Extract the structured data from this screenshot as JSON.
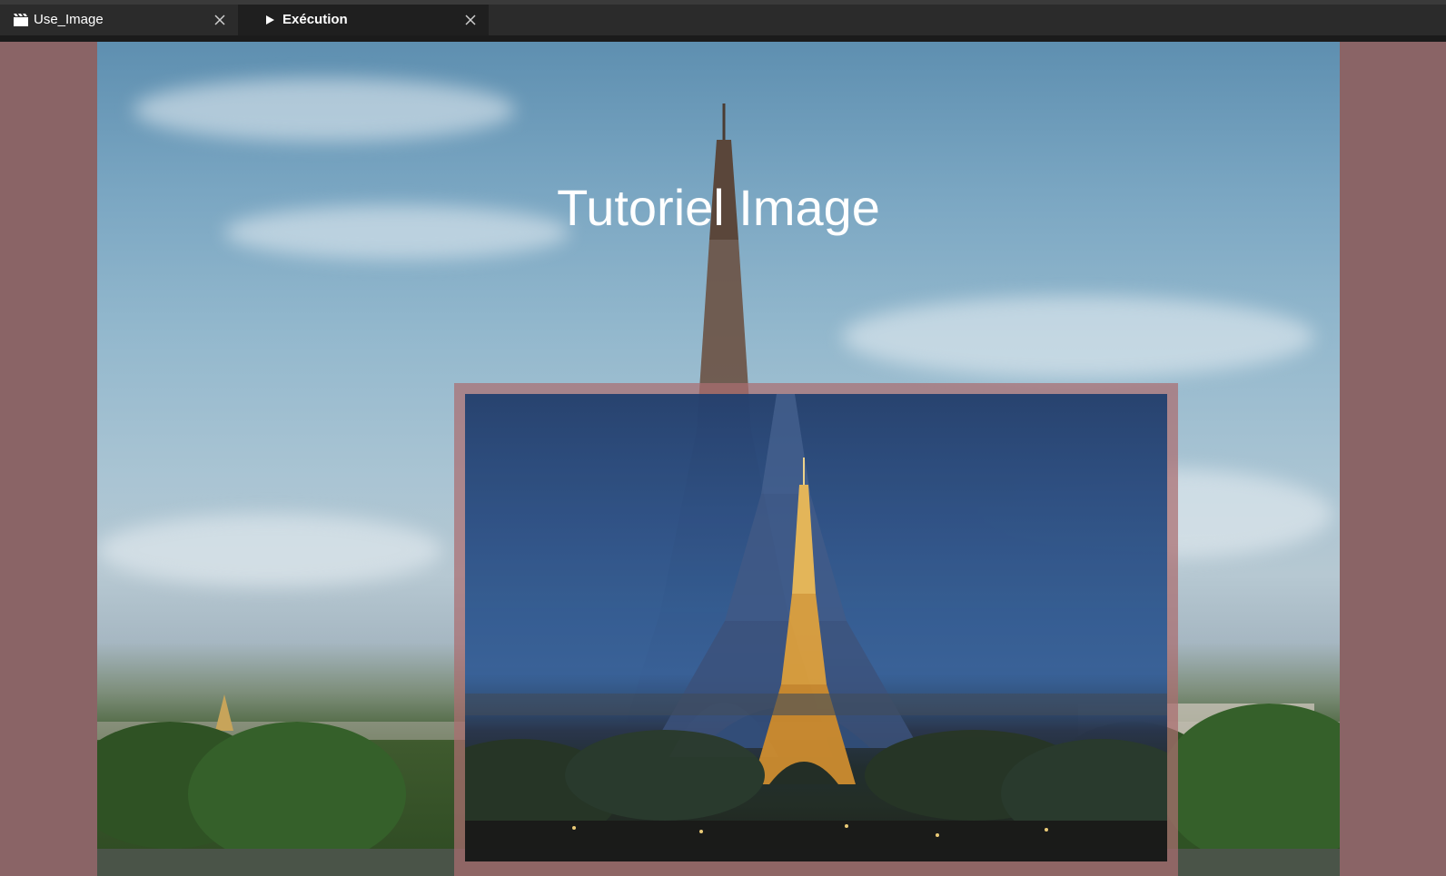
{
  "tabs": [
    {
      "label": "Use_Image",
      "icon": "clapperboard-icon",
      "active": false
    },
    {
      "label": "Exécution",
      "icon": "play-icon",
      "active": true
    }
  ],
  "scene": {
    "title": "Tutoriel Image",
    "background_image": "eiffel-tower-daytime-photo",
    "overlay_image": "eiffel-tower-night-photo"
  },
  "colors": {
    "stage_background": "#8a6466",
    "tabbar_background": "#2b2b2b",
    "overlay_border": "#aa6e70"
  }
}
